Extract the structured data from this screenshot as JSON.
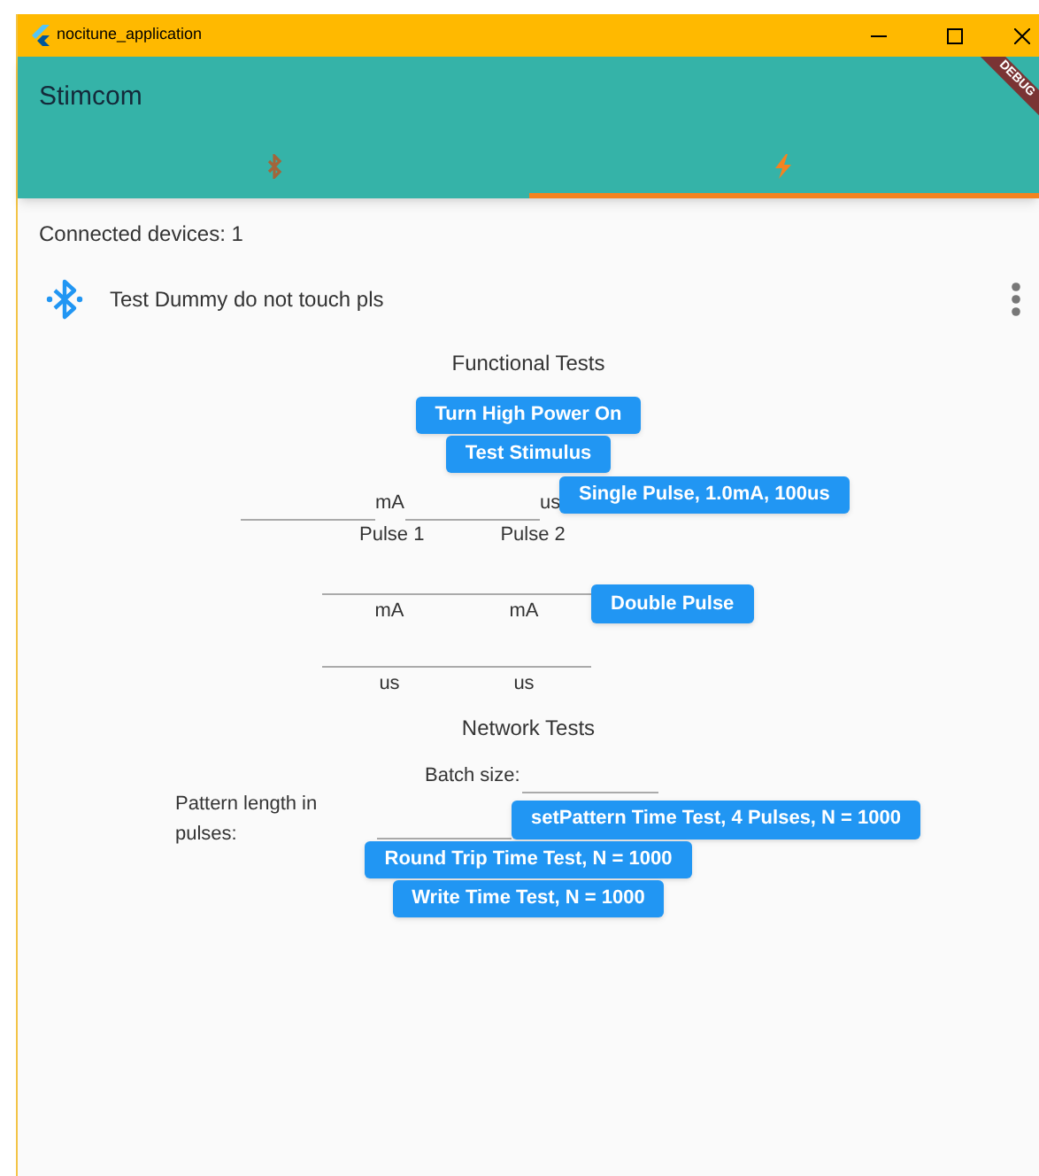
{
  "window": {
    "title": "nocitune_application"
  },
  "app_bar": {
    "title": "Stimcom",
    "debug_banner": "DEBUG"
  },
  "tabs": [
    {
      "kind": "bluetooth",
      "selected": false
    },
    {
      "kind": "flash",
      "selected": true
    }
  ],
  "connected_devices": "Connected devices: 1",
  "device": {
    "name": "Test Dummy do not touch pls"
  },
  "functional_tests": {
    "title": "Functional Tests",
    "buttons": [
      "Turn High Power On",
      "Test Stimulus"
    ],
    "single_pulse": {
      "fields": [
        {
          "suffix": "mA",
          "helper": "Pulse 1"
        },
        {
          "suffix": "us",
          "helper": "Pulse 2"
        }
      ],
      "button": "Single Pulse, 1.0mA, 100us"
    },
    "double_pulse": {
      "current_fields": [
        {
          "helper": "mA"
        },
        {
          "helper": "mA"
        }
      ],
      "button": "Double Pulse",
      "duration_fields": [
        {
          "helper": "us"
        },
        {
          "helper": "us"
        }
      ]
    }
  },
  "network_tests": {
    "title": "Network Tests",
    "batch_size_label": "Batch size:",
    "pattern_length_label": "Pattern length in pulses:",
    "buttons": [
      "setPattern Time Test, 4 Pulses, N = 1000",
      "Round Trip Time Test, N = 1000",
      "Write Time Test, N = 1000"
    ]
  }
}
